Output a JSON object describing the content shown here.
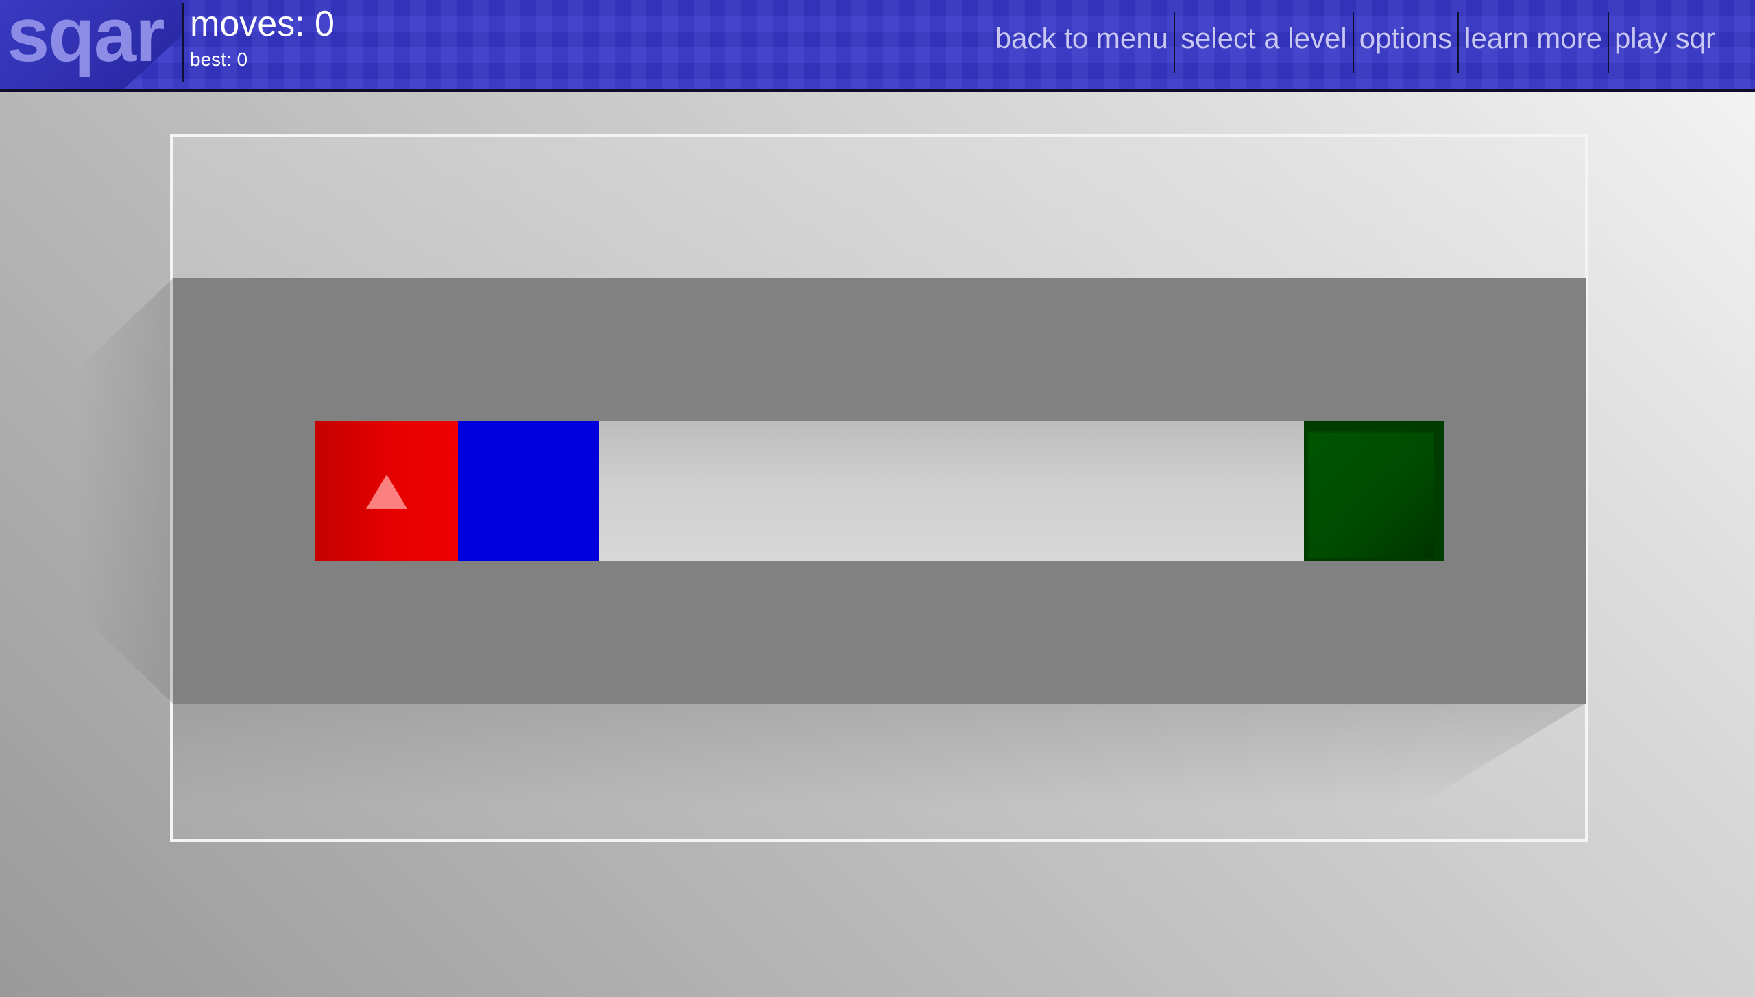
{
  "header": {
    "logo": "sqar",
    "moves": "moves: 0",
    "best": "best: 0"
  },
  "nav": [
    {
      "label": "back to menu"
    },
    {
      "label": "select a level"
    },
    {
      "label": "options"
    },
    {
      "label": "learn more"
    },
    {
      "label": "play sqr"
    }
  ],
  "board": {
    "colors": {
      "header": "#3737c8",
      "wall": "#818181",
      "player_tile": "#e60000",
      "blue_tile": "#0000dd",
      "goal_tile": "#005500",
      "track": "#cfcfcf"
    },
    "player_icon": "up-arrow-icon"
  }
}
